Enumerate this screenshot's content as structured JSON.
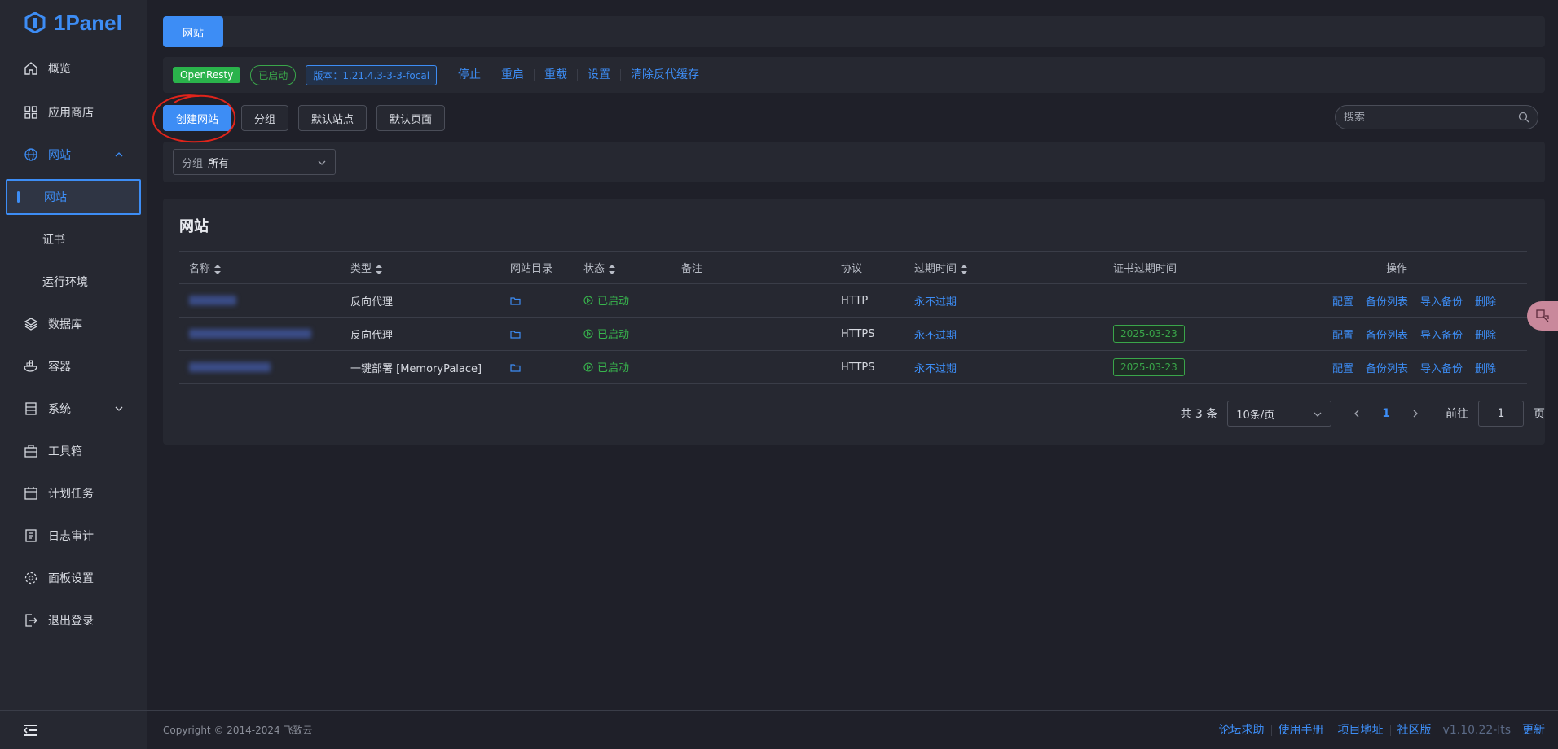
{
  "app": {
    "logo_text": "1Panel"
  },
  "sidebar": {
    "items": [
      {
        "label": "概览",
        "icon": "home-icon"
      },
      {
        "label": "应用商店",
        "icon": "grid-icon"
      },
      {
        "label": "网站",
        "icon": "globe-icon",
        "expanded": true
      },
      {
        "label": "数据库",
        "icon": "layers-icon"
      },
      {
        "label": "容器",
        "icon": "docker-icon"
      },
      {
        "label": "系统",
        "icon": "server-icon"
      },
      {
        "label": "工具箱",
        "icon": "toolbox-icon"
      },
      {
        "label": "计划任务",
        "icon": "calendar-icon"
      },
      {
        "label": "日志审计",
        "icon": "log-icon"
      },
      {
        "label": "面板设置",
        "icon": "gear-icon"
      },
      {
        "label": "退出登录",
        "icon": "logout-icon"
      }
    ],
    "sub_items": [
      {
        "label": "网站",
        "active": true
      },
      {
        "label": "证书"
      },
      {
        "label": "运行环境"
      }
    ]
  },
  "header": {
    "tab_label": "网站"
  },
  "status_bar": {
    "app_name": "OpenResty",
    "state": "已启动",
    "version": "版本：1.21.4.3-3-3-focal",
    "actions": [
      "停止",
      "重启",
      "重载",
      "设置",
      "清除反代缓存"
    ]
  },
  "toolbar": {
    "create_label": "创建网站",
    "group_label": "分组",
    "default_site_label": "默认站点",
    "default_page_label": "默认页面",
    "search_placeholder": "搜索"
  },
  "filter": {
    "label": "分组",
    "value": "所有"
  },
  "table": {
    "title": "网站",
    "columns": [
      "名称",
      "类型",
      "网站目录",
      "状态",
      "备注",
      "协议",
      "过期时间",
      "证书过期时间",
      "操作"
    ],
    "rows": [
      {
        "type": "反向代理",
        "status": "已启动",
        "protocol": "HTTP",
        "expire": "永不过期",
        "cert_expire": ""
      },
      {
        "type": "反向代理",
        "status": "已启动",
        "protocol": "HTTPS",
        "expire": "永不过期",
        "cert_expire": "2025-03-23"
      },
      {
        "type": "一键部署 [MemoryPalace]",
        "status": "已启动",
        "protocol": "HTTPS",
        "expire": "永不过期",
        "cert_expire": "2025-03-23"
      }
    ],
    "row_actions": [
      "配置",
      "备份列表",
      "导入备份",
      "删除"
    ]
  },
  "pagination": {
    "total": "共 3 条",
    "page_size": "10条/页",
    "current": "1",
    "goto_label": "前往",
    "goto_value": "1",
    "page_suffix": "页"
  },
  "footer": {
    "copyright": "Copyright © 2014-2024 飞致云",
    "links": [
      "论坛求助",
      "使用手册",
      "项目地址",
      "社区版"
    ],
    "version": "v1.10.22-lts",
    "update": "更新"
  },
  "colors": {
    "accent": "#3d8df5",
    "success": "#38b54d",
    "bg": "#1f2029",
    "panel": "#262831"
  }
}
